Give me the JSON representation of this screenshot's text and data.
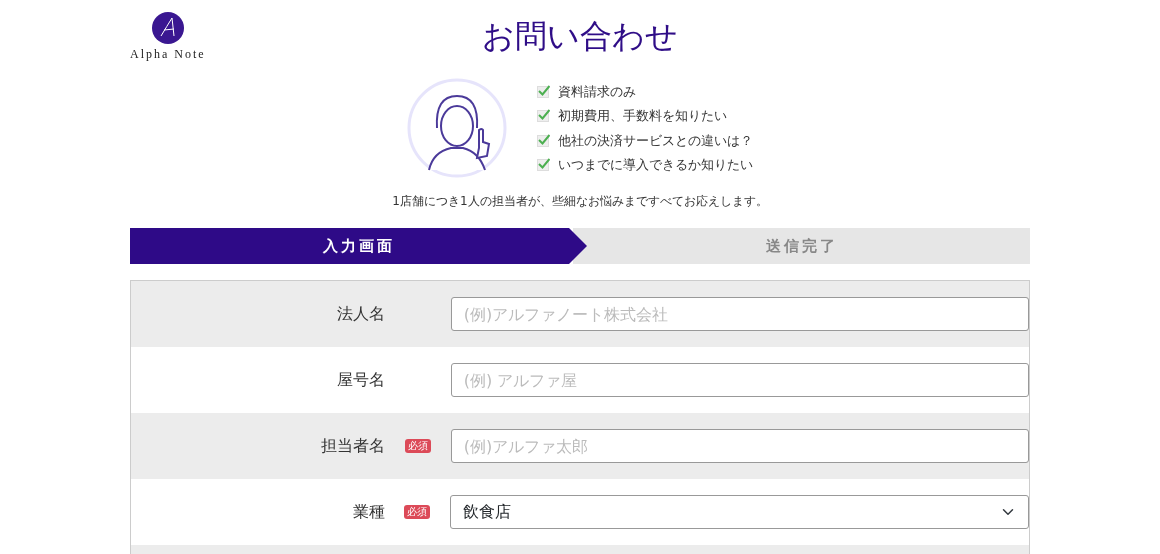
{
  "logo": {
    "text": "Alpha Note"
  },
  "title": "お問い合わせ",
  "checklist": [
    {
      "text": "資料請求のみ",
      "checked": true
    },
    {
      "text": "初期費用、手数料を知りたい",
      "checked": true
    },
    {
      "text": "他社の決済サービスとの違いは？",
      "checked": true
    },
    {
      "text": "いつまでに導入できるか知りたい",
      "checked": true
    }
  ],
  "tagline": "1店舗につき1人の担当者が、些細なお悩みまですべてお応えします。",
  "steps": [
    {
      "label": "入力画面",
      "selected": true
    },
    {
      "label": "送信完了",
      "selected": false
    }
  ],
  "form": {
    "fields": [
      {
        "label": "法人名",
        "kind": "input",
        "placeholder": "(例)アルファノート株式会社"
      },
      {
        "label": "屋号名",
        "kind": "input",
        "placeholder": "(例) アルファ屋"
      },
      {
        "label": "担当者名",
        "kind": "input",
        "required_tag": "必須",
        "placeholder": "(例)アルファ太郎"
      },
      {
        "label": "業種",
        "kind": "select",
        "required_tag": "必須",
        "value": "飲食店"
      }
    ]
  }
}
